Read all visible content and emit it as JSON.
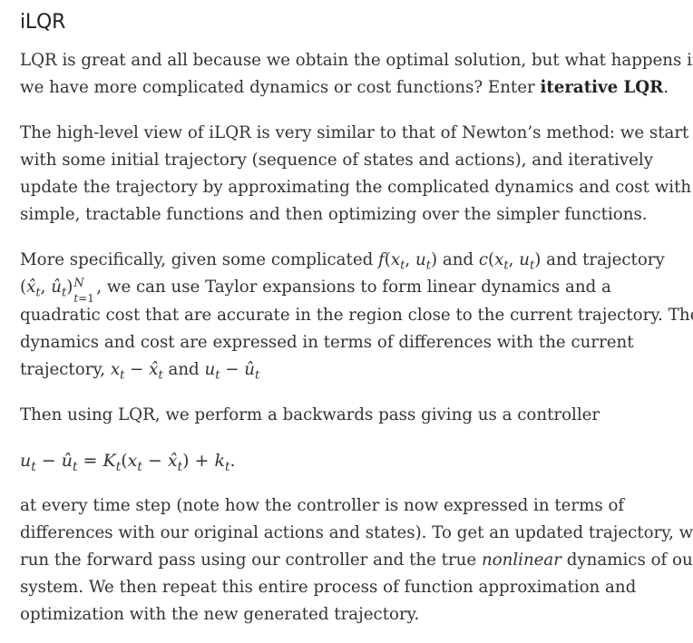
{
  "heading": "iLQR",
  "p1": {
    "line1": "LQR is great and all because we obtain the optimal solution, but what happens if",
    "line2_pre": "we have more complicated dynamics or cost functions? Enter ",
    "line2_bold": "iterative LQR",
    "line2_post": "."
  },
  "p2": {
    "line1": "The high-level view of iLQR is very similar to that of Newton’s method: we start",
    "line2": "with some initial trajectory (sequence of states and actions), and iteratively",
    "line3": "update the trajectory by approximating the complicated dynamics and cost with",
    "line4": "simple, tractable functions and then optimizing over the simpler functions."
  },
  "p3": {
    "line1_pre": "More specifically, given some complicated ",
    "line1_mid": " and ",
    "line1_post": " and trajectory",
    "line2_post": ", we can use Taylor expansions to form linear dynamics and a",
    "line3": "quadratic cost that are accurate in the region close to the current trajectory. The",
    "line4": "dynamics and cost are expressed in terms of differences with the current",
    "line5_pre": "trajectory, ",
    "line5_mid": " and "
  },
  "p4": {
    "line1": "Then using LQR, we perform a backwards pass giving us a controller"
  },
  "p5": {
    "line1": "at every time step (note how the controller is now expressed in terms of",
    "line2": "differences with our original actions and states). To get an updated trajectory, we",
    "line3_pre": "run the forward pass using our controller and the true ",
    "line3_em": "nonlinear",
    "line3_post": " dynamics of our",
    "line4": "system. We then repeat this entire process of function approximation and",
    "line5": "optimization with the new generated trajectory."
  }
}
